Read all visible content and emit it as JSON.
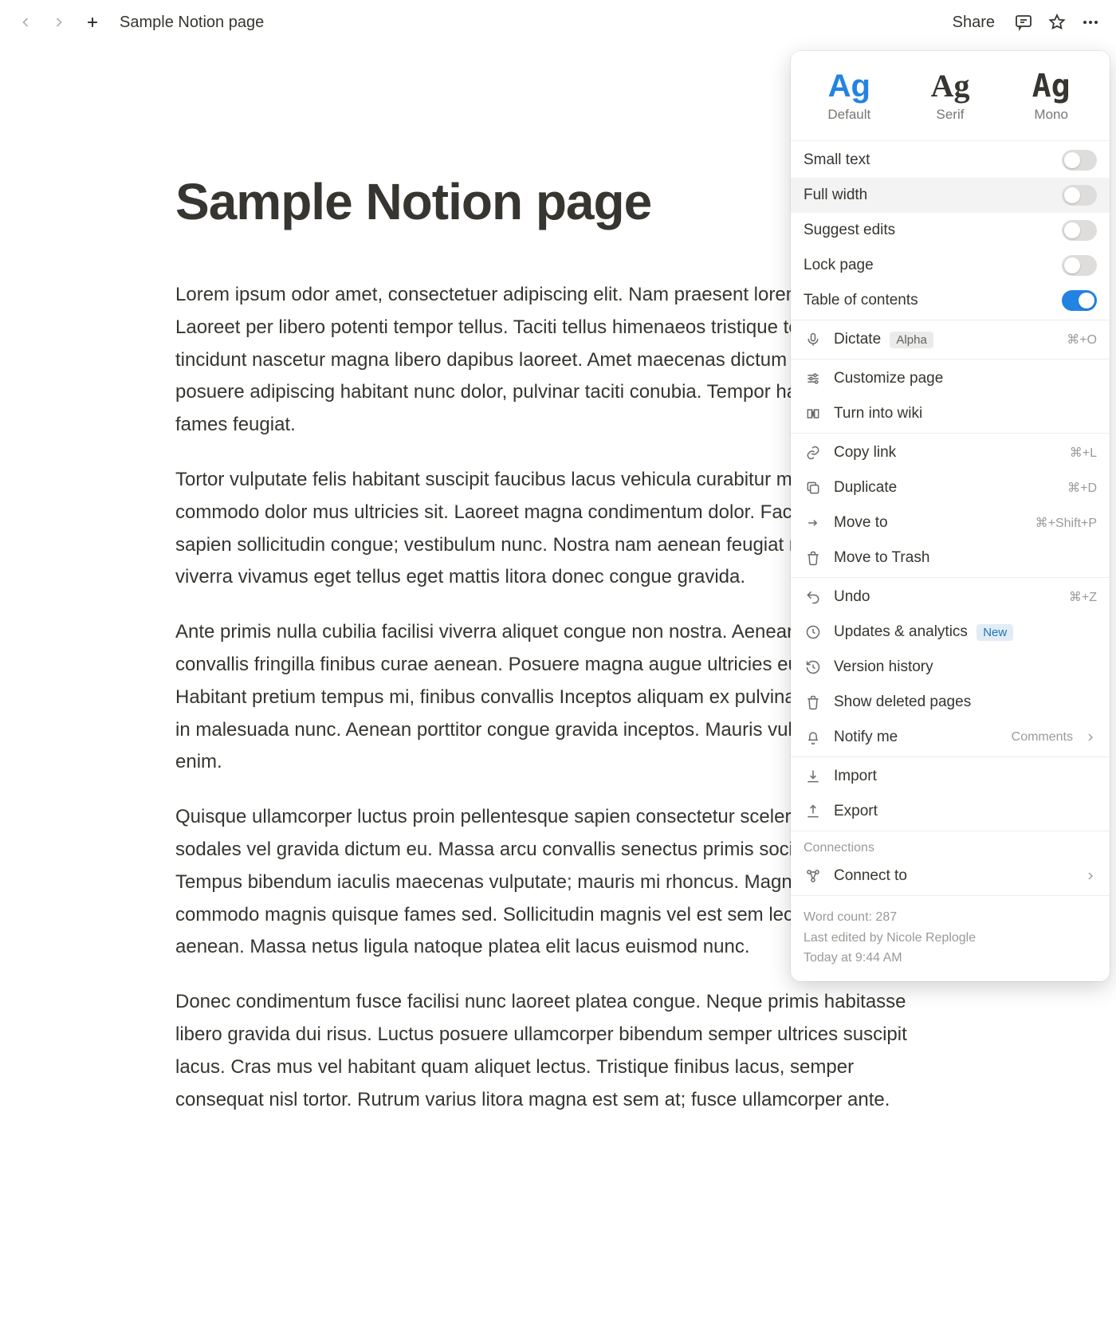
{
  "topbar": {
    "breadcrumb": "Sample Notion page",
    "share": "Share"
  },
  "page": {
    "title": "Sample Notion page",
    "paragraphs": [
      "Lorem ipsum odor amet, consectetuer adipiscing elit. Nam praesent lorem enim congue. Laoreet per libero potenti tempor tellus. Taciti tellus himenaeos tristique tellus! Odio tincidunt nascetur magna libero dapibus laoreet. Amet maecenas dictum aliquam pulvinar posuere adipiscing habitant nunc dolor, pulvinar taciti conubia. Tempor habitasse erat fames feugiat.",
      "Tortor vulputate felis habitant suscipit faucibus lacus vehicula curabitur maecenas torquent commodo dolor mus ultricies sit. Laoreet magna condimentum dolor. Facilisi feugiat sapien sollicitudin congue; vestibulum nunc. Nostra nam aenean feugiat rutrum, nullam viverra vivamus eget tellus eget mattis litora donec congue gravida.",
      "Ante primis nulla cubilia facilisi viverra aliquet congue non nostra. Aenean senectus convallis fringilla finibus curae aenean. Posuere magna augue ultricies eu quis cubilia ex. Habitant pretium tempus mi, finibus convallis Inceptos aliquam ex pulvinar tincidunt libero in malesuada nunc. Aenean porttitor congue gravida inceptos. Mauris vulputate eu et hac enim.",
      "Quisque ullamcorper luctus proin pellentesque sapien consectetur scelerisque semper sodales vel gravida dictum eu. Massa arcu convallis senectus primis sociosqu habitant. Tempus bibendum iaculis maecenas vulputate; mauris mi rhoncus. Magna sodales varius commodo magnis quisque fames sed. Sollicitudin magnis vel est sem lectus luctus aenean. Massa netus ligula natoque platea elit lacus euismod nunc.",
      "Donec condimentum fusce facilisi nunc laoreet platea congue. Neque primis habitasse libero gravida dui risus. Luctus posuere ullamcorper bibendum semper ultrices suscipit lacus. Cras mus vel habitant quam aliquet lectus. Tristique finibus lacus, semper consequat nisl tortor. Rutrum varius litora magna est sem at; fusce ullamcorper ante."
    ]
  },
  "menu": {
    "fonts": {
      "default": "Default",
      "serif": "Serif",
      "mono": "Mono",
      "sample": "Ag"
    },
    "toggles": {
      "small_text": {
        "label": "Small text",
        "on": false
      },
      "full_width": {
        "label": "Full width",
        "on": false
      },
      "suggest_edits": {
        "label": "Suggest edits",
        "on": false
      },
      "lock_page": {
        "label": "Lock page",
        "on": false
      },
      "toc": {
        "label": "Table of contents",
        "on": true
      }
    },
    "dictate": {
      "label": "Dictate",
      "badge": "Alpha",
      "shortcut": "⌘+O"
    },
    "customize": "Customize page",
    "turn_wiki": "Turn into wiki",
    "copy_link": {
      "label": "Copy link",
      "shortcut": "⌘+L"
    },
    "duplicate": {
      "label": "Duplicate",
      "shortcut": "⌘+D"
    },
    "move_to": {
      "label": "Move to",
      "shortcut": "⌘+Shift+P"
    },
    "trash": "Move to Trash",
    "undo": {
      "label": "Undo",
      "shortcut": "⌘+Z"
    },
    "updates": {
      "label": "Updates & analytics",
      "badge": "New"
    },
    "version": "Version history",
    "deleted": "Show deleted pages",
    "notify": {
      "label": "Notify me",
      "value": "Comments"
    },
    "import": "Import",
    "export": "Export",
    "connections_header": "Connections",
    "connect_to": "Connect to",
    "footer": {
      "word_count": "Word count: 287",
      "last_edited": "Last edited by Nicole Replogle",
      "time": "Today at 9:44 AM"
    }
  }
}
